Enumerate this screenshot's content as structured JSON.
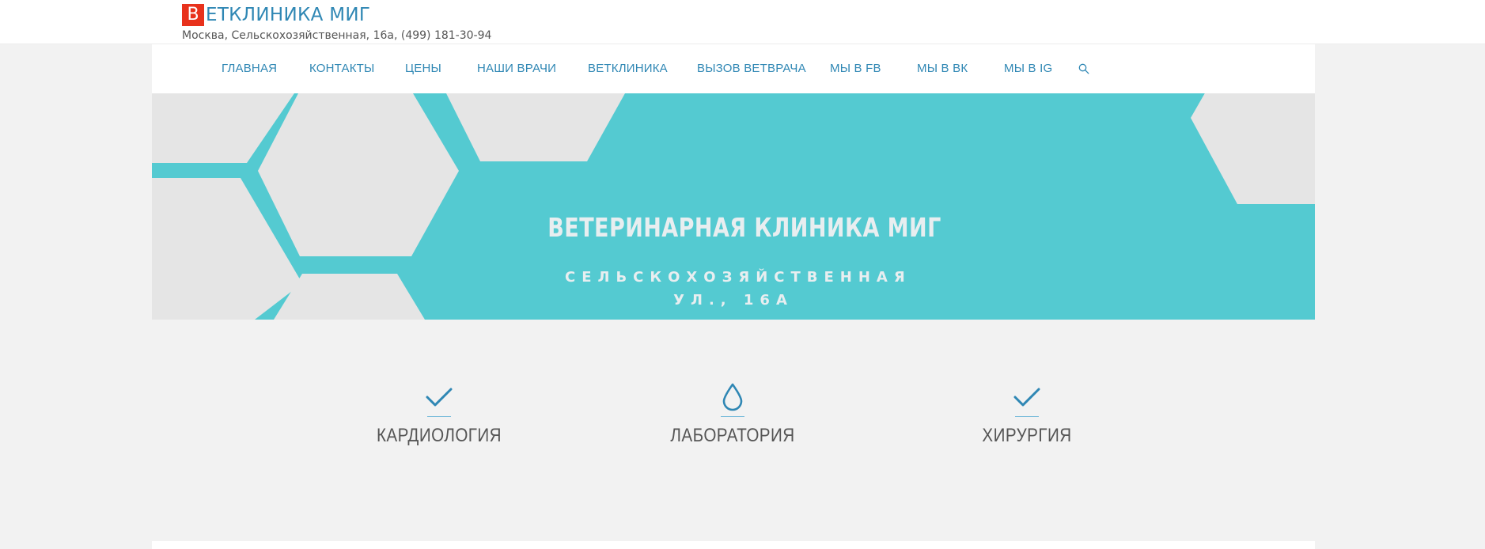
{
  "site": {
    "logo_letter": "В",
    "logo_text": "ЕТКЛИНИКА МИГ",
    "address": "Москва, Сельскохозяйственная, 16а, (499) 181-30-94"
  },
  "nav": {
    "items": [
      {
        "label": "ГЛАВНАЯ"
      },
      {
        "label": "КОНТАКТЫ"
      },
      {
        "label": "ЦЕНЫ"
      },
      {
        "label": "НАШИ ВРАЧИ"
      },
      {
        "label": "ВЕТКЛИНИКА"
      },
      {
        "label": "ВЫЗОВ ВЕТВРАЧА"
      },
      {
        "label": "МЫ В FB"
      },
      {
        "label": "МЫ В ВК"
      },
      {
        "label": "МЫ В IG"
      }
    ],
    "search_icon": "search-icon"
  },
  "hero": {
    "title": "ВЕТЕРИНАРНАЯ КЛИНИКА МИГ",
    "subtitle_line1": "СЕЛЬСКОХОЗЯЙСТВЕННАЯ",
    "subtitle_line2": "УЛ., 16А"
  },
  "features": [
    {
      "icon": "check-icon",
      "label": "КАРДИОЛОГИЯ"
    },
    {
      "icon": "drop-icon",
      "label": "ЛАБОРАТОРИЯ"
    },
    {
      "icon": "check-icon",
      "label": "ХИРУРГИЯ"
    }
  ],
  "colors": {
    "accent": "#2f87b4",
    "logo_red": "#e8321c",
    "hero_teal": "#54cad1",
    "hero_gray": "#e5e5e5",
    "background": "#f2f2f2"
  }
}
